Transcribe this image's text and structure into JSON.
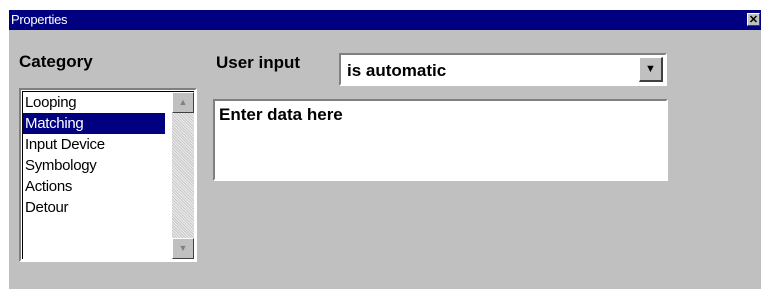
{
  "window": {
    "title": "Properties",
    "close_glyph": "✕"
  },
  "category": {
    "label": "Category",
    "items": [
      {
        "label": "Looping",
        "selected": false
      },
      {
        "label": "Matching",
        "selected": true
      },
      {
        "label": "Input Device",
        "selected": false
      },
      {
        "label": "Symbology",
        "selected": false
      },
      {
        "label": "Actions",
        "selected": false
      },
      {
        "label": "Detour",
        "selected": false
      }
    ]
  },
  "user_input": {
    "label": "User input",
    "selected_value": "is automatic"
  },
  "data_entry": {
    "value": "Enter data here"
  },
  "icons": {
    "close": "close-icon",
    "scroll_up": "scroll-up-arrow-icon",
    "scroll_down": "scroll-down-arrow-icon",
    "dropdown": "dropdown-arrow-icon"
  },
  "colors": {
    "titlebar": "#000080",
    "selection": "#000080",
    "dialog_bg": "#c0c0c0"
  }
}
